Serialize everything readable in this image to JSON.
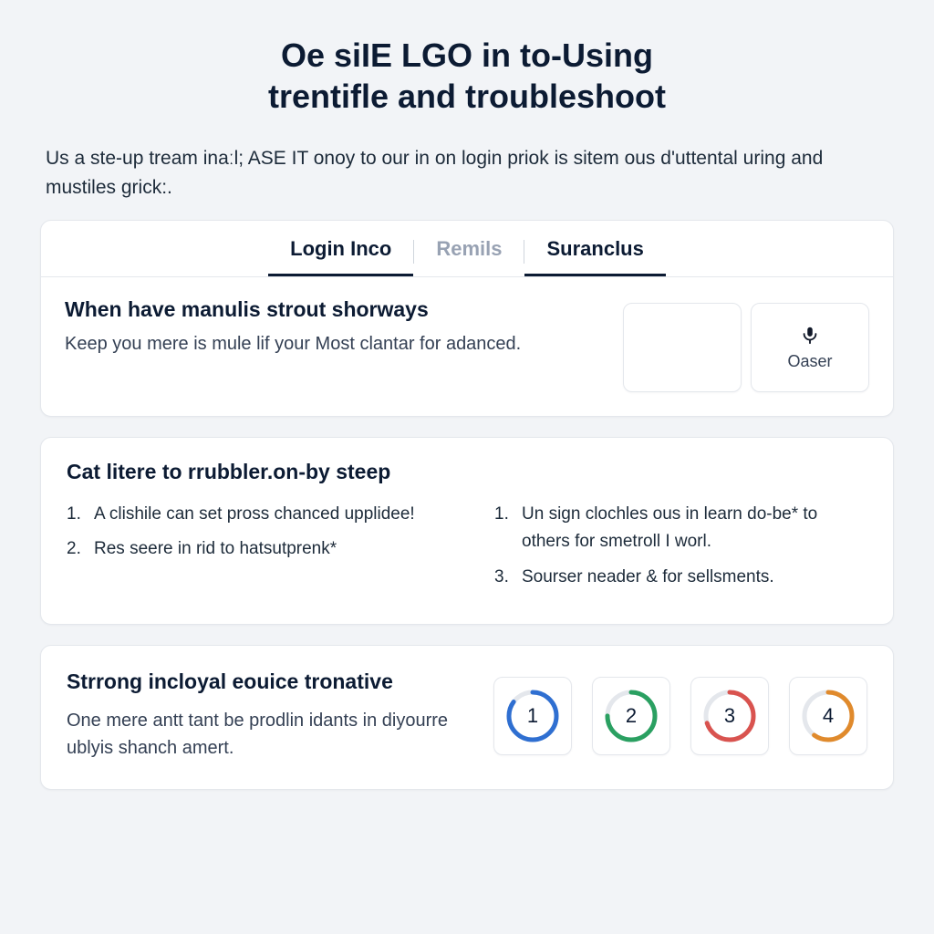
{
  "title_line1": "Oe siIE LGO in to-Using",
  "title_line2": "trentifle and troubleshoot",
  "intro": "Us a ste‑up tream inaːl; ASE IT onoy to our in on login priok is sitem ous d'uttental uring and mustiles grick:.",
  "tabs": [
    {
      "label": "Login Inco",
      "state": "active-primary"
    },
    {
      "label": "Remils",
      "state": "inactive"
    },
    {
      "label": "Suranclus",
      "state": "active-secondary"
    }
  ],
  "section1": {
    "heading": "When have manulis strout shorways",
    "body": "Keep you mere is mule lif your Most clantar for adanced.",
    "action_label": "Oaser"
  },
  "section2": {
    "heading": "Cat litere to rrubbler.on-by steep",
    "left": [
      "A clishile can set pross chanced upplidee!",
      "Res seere in rid to hatsutprenk*"
    ],
    "right": [
      "Un sign clochles ous in learn do-be* to others for smetroll I worl.",
      "Sourser neader & for sellsments."
    ],
    "right_start": 1
  },
  "section3": {
    "heading": "Strrong incloyal eouice tronative",
    "body": "One mere antt tant be prodlin idants in diyourre ublyis shanch amert.",
    "circles": [
      {
        "n": "1",
        "color": "#2f6fd1",
        "pct": 0.85
      },
      {
        "n": "2",
        "color": "#2aa061",
        "pct": 0.75
      },
      {
        "n": "3",
        "color": "#d9534f",
        "pct": 0.7
      },
      {
        "n": "4",
        "color": "#e08a2c",
        "pct": 0.6
      }
    ]
  }
}
